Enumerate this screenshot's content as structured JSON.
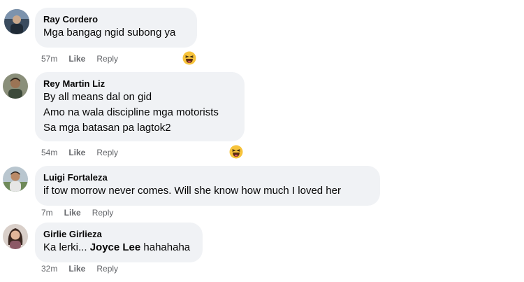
{
  "comments": [
    {
      "author": "Ray Cordero",
      "lines": [
        "Mga bangag ngid subong ya"
      ],
      "time": "57m",
      "like": "Like",
      "reply": "Reply",
      "reaction": "haha-reaction-icon"
    },
    {
      "author": "Rey Martin Liz",
      "lines": [
        "By all means dal on gid",
        "Amo na wala discipline mga motorists",
        "Sa mga batasan pa lagtok2"
      ],
      "time": "54m",
      "like": "Like",
      "reply": "Reply",
      "reaction": "haha-reaction-icon"
    },
    {
      "author": "Luigi Fortaleza",
      "lines": [
        "if tow morrow never comes. Will she know how much I loved her"
      ],
      "time": "7m",
      "like": "Like",
      "reply": "Reply"
    },
    {
      "author": "Girlie Girlieza",
      "text_prefix": "Ka lerki... ",
      "mention": "Joyce Lee",
      "text_suffix": " hahahaha",
      "time": "32m",
      "like": "Like",
      "reply": "Reply"
    }
  ],
  "colors": {
    "bubble": "#f0f2f5",
    "meta_text": "#65676b",
    "text": "#050505",
    "haha_yellow": "#f7c33b"
  }
}
